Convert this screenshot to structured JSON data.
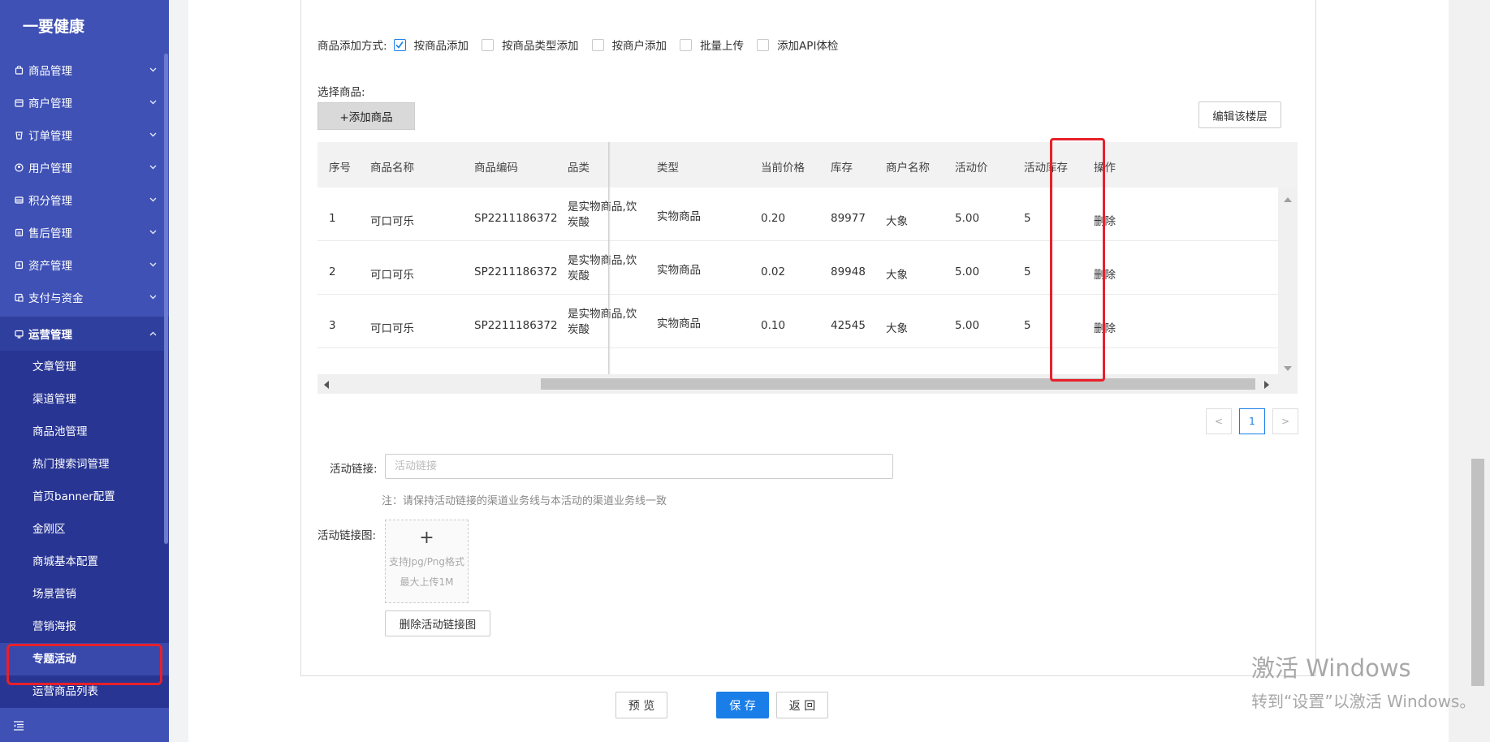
{
  "app": {
    "logo": "一要健康"
  },
  "sidebar": {
    "menus": [
      {
        "label": "商品管理",
        "icon": "goods-icon"
      },
      {
        "label": "商户管理",
        "icon": "store-icon"
      },
      {
        "label": "订单管理",
        "icon": "order-icon"
      },
      {
        "label": "用户管理",
        "icon": "user-icon"
      },
      {
        "label": "积分管理",
        "icon": "points-icon"
      },
      {
        "label": "售后管理",
        "icon": "aftersale-icon"
      },
      {
        "label": "资产管理",
        "icon": "asset-icon"
      },
      {
        "label": "支付与资金",
        "icon": "payment-icon"
      }
    ],
    "open_menu": {
      "label": "运营管理",
      "icon": "operation-icon"
    },
    "sub_items": [
      {
        "label": "文章管理"
      },
      {
        "label": "渠道管理"
      },
      {
        "label": "商品池管理"
      },
      {
        "label": "热门搜索词管理"
      },
      {
        "label": "首页banner配置"
      },
      {
        "label": "金刚区"
      },
      {
        "label": "商城基本配置"
      },
      {
        "label": "场景营销"
      },
      {
        "label": "营销海报"
      },
      {
        "label": "专题活动"
      },
      {
        "label": "运营商品列表"
      }
    ],
    "active_sub": "专题活动"
  },
  "form": {
    "add_mode_label": "商品添加方式:",
    "add_mode_options": [
      {
        "label": "按商品添加",
        "checked": true
      },
      {
        "label": "按商品类型添加",
        "checked": false
      },
      {
        "label": "按商户添加",
        "checked": false
      },
      {
        "label": "批量上传",
        "checked": false
      },
      {
        "label": "添加API体检",
        "checked": false
      }
    ],
    "select_goods_label": "选择商品:",
    "add_goods_button": "+添加商品",
    "edit_floor_button": "编辑该楼层"
  },
  "table": {
    "columns": [
      "序号",
      "商品名称",
      "商品编码",
      "品类",
      "类型",
      "当前价格",
      "库存",
      "商户名称",
      "活动价",
      "活动库存",
      "操作"
    ],
    "rows": [
      {
        "no": "1",
        "name": "可口可乐",
        "code": "SP2211186372",
        "category_l1": "是实物商品,饮",
        "category_l2": "炭酸",
        "type": "实物商品",
        "price": "0.20",
        "stock": "89977",
        "merchant": "大象",
        "act_price": "5.00",
        "act_stock": "5",
        "action": "删除"
      },
      {
        "no": "2",
        "name": "可口可乐",
        "code": "SP2211186372",
        "category_l1": "是实物商品,饮",
        "category_l2": "炭酸",
        "type": "实物商品",
        "price": "0.02",
        "stock": "89948",
        "merchant": "大象",
        "act_price": "5.00",
        "act_stock": "5",
        "action": "删除"
      },
      {
        "no": "3",
        "name": "可口可乐",
        "code": "SP2211186372",
        "category_l1": "是实物商品,饮",
        "category_l2": "炭酸",
        "type": "实物商品",
        "price": "0.10",
        "stock": "42545",
        "merchant": "大象",
        "act_price": "5.00",
        "act_stock": "5",
        "action": "删除"
      }
    ],
    "category_header": "品类"
  },
  "pagination": {
    "prev": "<",
    "current": "1",
    "next": ">"
  },
  "activity": {
    "link_label": "活动链接:",
    "link_placeholder": "活动链接",
    "link_value": "",
    "note": "注：请保持活动链接的渠道业务线与本活动的渠道业务线一致",
    "image_label": "活动链接图:",
    "upload_plus": "+",
    "upload_hint1": "支持Jpg/Png格式",
    "upload_hint2": "最大上传1M",
    "delete_image_button": "删除活动链接图"
  },
  "footer_buttons": {
    "preview": "预 览",
    "save": "保 存",
    "back": "返 回"
  },
  "watermark": {
    "line1": "激活 Windows",
    "line2": "转到“设置”以激活 Windows。"
  },
  "colors": {
    "sidebar": "#3f51b5",
    "submenu": "#283593",
    "primary": "#1a7ee8",
    "highlight": "#e8202a"
  }
}
